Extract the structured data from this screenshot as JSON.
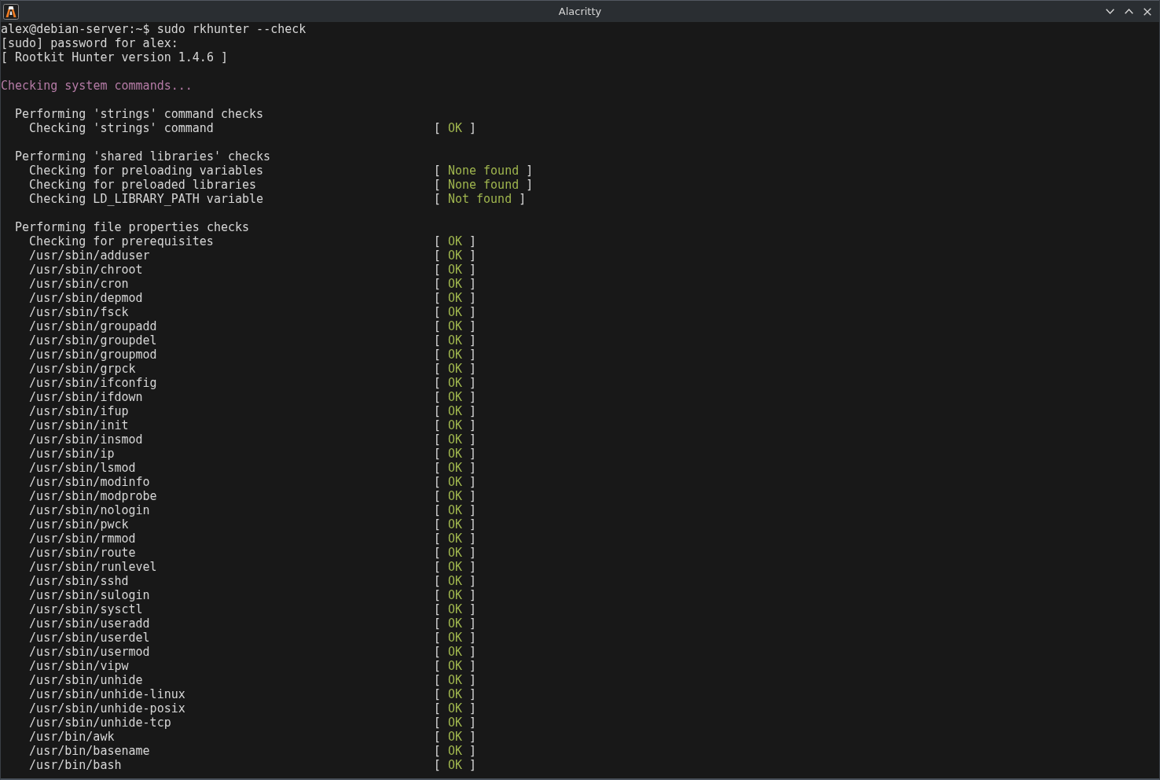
{
  "window": {
    "title": "Alacritty"
  },
  "terminal": {
    "lines": [
      "alex@debian-server:~$ sudo rkhunter --check",
      "[sudo] password for alex:",
      "[ Rootkit Hunter version 1.4.6 ]"
    ],
    "stages": [
      {
        "title": "Checking system commands...",
        "sections": [
          {
            "title": "Performing 'strings' command checks",
            "checks": [
              {
                "label": "Checking 'strings' command",
                "status": {
                  "open": "[",
                  "result": "OK",
                  "close": "]"
                }
              }
            ]
          },
          {
            "title": "Performing 'shared libraries' checks",
            "checks": [
              {
                "label": "Checking for preloading variables",
                "status": {
                  "open": "[",
                  "result": "None found",
                  "close": "]"
                }
              },
              {
                "label": "Checking for preloaded libraries",
                "status": {
                  "open": "[",
                  "result": "None found",
                  "close": "]"
                }
              },
              {
                "label": "Checking LD_LIBRARY_PATH variable",
                "status": {
                  "open": "[",
                  "result": "Not found",
                  "close": "]"
                }
              }
            ]
          },
          {
            "title": "Performing file properties checks",
            "checks": [
              {
                "label": "Checking for prerequisites",
                "status": {
                  "open": "[",
                  "result": "OK",
                  "close": "]"
                }
              },
              {
                "label": "/usr/sbin/adduser",
                "status": {
                  "open": "[",
                  "result": "OK",
                  "close": "]"
                }
              },
              {
                "label": "/usr/sbin/chroot",
                "status": {
                  "open": "[",
                  "result": "OK",
                  "close": "]"
                }
              },
              {
                "label": "/usr/sbin/cron",
                "status": {
                  "open": "[",
                  "result": "OK",
                  "close": "]"
                }
              },
              {
                "label": "/usr/sbin/depmod",
                "status": {
                  "open": "[",
                  "result": "OK",
                  "close": "]"
                }
              },
              {
                "label": "/usr/sbin/fsck",
                "status": {
                  "open": "[",
                  "result": "OK",
                  "close": "]"
                }
              },
              {
                "label": "/usr/sbin/groupadd",
                "status": {
                  "open": "[",
                  "result": "OK",
                  "close": "]"
                }
              },
              {
                "label": "/usr/sbin/groupdel",
                "status": {
                  "open": "[",
                  "result": "OK",
                  "close": "]"
                }
              },
              {
                "label": "/usr/sbin/groupmod",
                "status": {
                  "open": "[",
                  "result": "OK",
                  "close": "]"
                }
              },
              {
                "label": "/usr/sbin/grpck",
                "status": {
                  "open": "[",
                  "result": "OK",
                  "close": "]"
                }
              },
              {
                "label": "/usr/sbin/ifconfig",
                "status": {
                  "open": "[",
                  "result": "OK",
                  "close": "]"
                }
              },
              {
                "label": "/usr/sbin/ifdown",
                "status": {
                  "open": "[",
                  "result": "OK",
                  "close": "]"
                }
              },
              {
                "label": "/usr/sbin/ifup",
                "status": {
                  "open": "[",
                  "result": "OK",
                  "close": "]"
                }
              },
              {
                "label": "/usr/sbin/init",
                "status": {
                  "open": "[",
                  "result": "OK",
                  "close": "]"
                }
              },
              {
                "label": "/usr/sbin/insmod",
                "status": {
                  "open": "[",
                  "result": "OK",
                  "close": "]"
                }
              },
              {
                "label": "/usr/sbin/ip",
                "status": {
                  "open": "[",
                  "result": "OK",
                  "close": "]"
                }
              },
              {
                "label": "/usr/sbin/lsmod",
                "status": {
                  "open": "[",
                  "result": "OK",
                  "close": "]"
                }
              },
              {
                "label": "/usr/sbin/modinfo",
                "status": {
                  "open": "[",
                  "result": "OK",
                  "close": "]"
                }
              },
              {
                "label": "/usr/sbin/modprobe",
                "status": {
                  "open": "[",
                  "result": "OK",
                  "close": "]"
                }
              },
              {
                "label": "/usr/sbin/nologin",
                "status": {
                  "open": "[",
                  "result": "OK",
                  "close": "]"
                }
              },
              {
                "label": "/usr/sbin/pwck",
                "status": {
                  "open": "[",
                  "result": "OK",
                  "close": "]"
                }
              },
              {
                "label": "/usr/sbin/rmmod",
                "status": {
                  "open": "[",
                  "result": "OK",
                  "close": "]"
                }
              },
              {
                "label": "/usr/sbin/route",
                "status": {
                  "open": "[",
                  "result": "OK",
                  "close": "]"
                }
              },
              {
                "label": "/usr/sbin/runlevel",
                "status": {
                  "open": "[",
                  "result": "OK",
                  "close": "]"
                }
              },
              {
                "label": "/usr/sbin/sshd",
                "status": {
                  "open": "[",
                  "result": "OK",
                  "close": "]"
                }
              },
              {
                "label": "/usr/sbin/sulogin",
                "status": {
                  "open": "[",
                  "result": "OK",
                  "close": "]"
                }
              },
              {
                "label": "/usr/sbin/sysctl",
                "status": {
                  "open": "[",
                  "result": "OK",
                  "close": "]"
                }
              },
              {
                "label": "/usr/sbin/useradd",
                "status": {
                  "open": "[",
                  "result": "OK",
                  "close": "]"
                }
              },
              {
                "label": "/usr/sbin/userdel",
                "status": {
                  "open": "[",
                  "result": "OK",
                  "close": "]"
                }
              },
              {
                "label": "/usr/sbin/usermod",
                "status": {
                  "open": "[",
                  "result": "OK",
                  "close": "]"
                }
              },
              {
                "label": "/usr/sbin/vipw",
                "status": {
                  "open": "[",
                  "result": "OK",
                  "close": "]"
                }
              },
              {
                "label": "/usr/sbin/unhide",
                "status": {
                  "open": "[",
                  "result": "OK",
                  "close": "]"
                }
              },
              {
                "label": "/usr/sbin/unhide-linux",
                "status": {
                  "open": "[",
                  "result": "OK",
                  "close": "]"
                }
              },
              {
                "label": "/usr/sbin/unhide-posix",
                "status": {
                  "open": "[",
                  "result": "OK",
                  "close": "]"
                }
              },
              {
                "label": "/usr/sbin/unhide-tcp",
                "status": {
                  "open": "[",
                  "result": "OK",
                  "close": "]"
                }
              },
              {
                "label": "/usr/bin/awk",
                "status": {
                  "open": "[",
                  "result": "OK",
                  "close": "]"
                }
              },
              {
                "label": "/usr/bin/basename",
                "status": {
                  "open": "[",
                  "result": "OK",
                  "close": "]"
                }
              },
              {
                "label": "/usr/bin/bash",
                "status": {
                  "open": "[",
                  "result": "OK",
                  "close": "]"
                }
              }
            ]
          }
        ]
      }
    ]
  }
}
